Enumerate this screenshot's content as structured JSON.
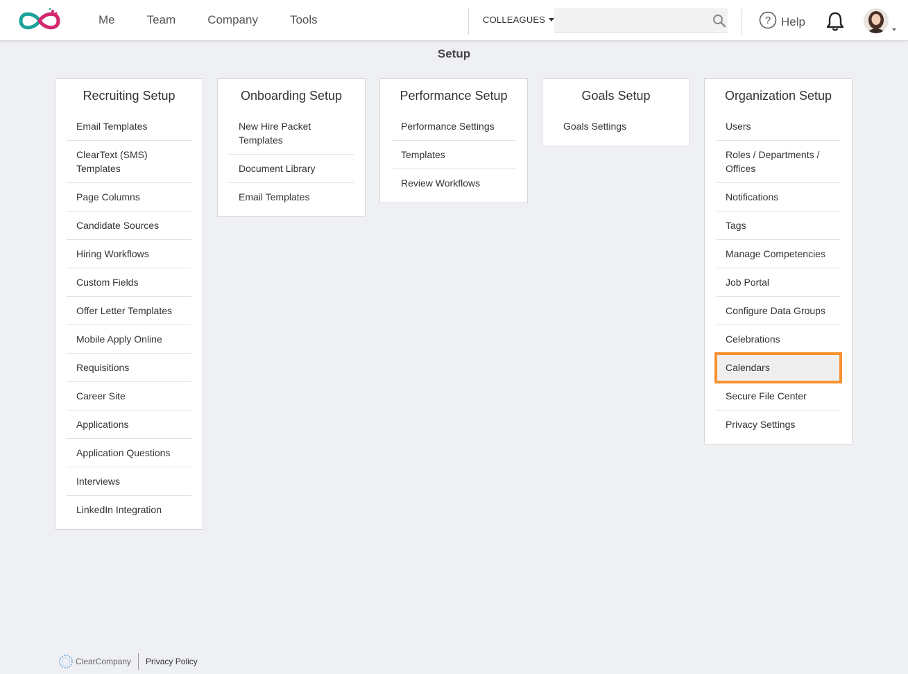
{
  "header": {
    "nav": [
      "Me",
      "Team",
      "Company",
      "Tools"
    ],
    "colleagues_label": "COLLEAGUES",
    "search_placeholder": "",
    "help_label": "Help"
  },
  "page": {
    "title": "Setup"
  },
  "cards": {
    "recruiting": {
      "title": "Recruiting Setup",
      "items": [
        "Email Templates",
        "ClearText (SMS) Templates",
        "Page Columns",
        "Candidate Sources",
        "Hiring Workflows",
        "Custom Fields",
        "Offer Letter Templates",
        "Mobile Apply Online",
        "Requisitions",
        "Career Site",
        "Applications",
        "Application Questions",
        "Interviews",
        "LinkedIn Integration"
      ]
    },
    "onboarding": {
      "title": "Onboarding Setup",
      "items": [
        "New Hire Packet Templates",
        "Document Library",
        "Email Templates"
      ]
    },
    "performance": {
      "title": "Performance Setup",
      "items": [
        "Performance Settings",
        "Templates",
        "Review Workflows"
      ]
    },
    "goals": {
      "title": "Goals Setup",
      "items": [
        "Goals Settings"
      ]
    },
    "organization": {
      "title": "Organization Setup",
      "items": [
        "Users",
        "Roles / Departments / Offices",
        "Notifications",
        "Tags",
        "Manage Competencies",
        "Job Portal",
        "Configure Data Groups",
        "Celebrations",
        "Calendars",
        "Secure File Center",
        "Privacy Settings"
      ],
      "highlighted_item": "Calendars"
    }
  },
  "footer": {
    "brand": "ClearCompany",
    "privacy_link": "Privacy Policy"
  },
  "colors": {
    "background": "#eef0f3",
    "highlight_border": "#f7922e",
    "logo_teal": "#1aa39a",
    "logo_pink": "#d6266e"
  },
  "icons": {
    "logo": "infinity-logo-icon",
    "search": "search-icon",
    "help": "question-circle-icon",
    "notifications": "bell-icon",
    "avatar": "user-avatar"
  }
}
